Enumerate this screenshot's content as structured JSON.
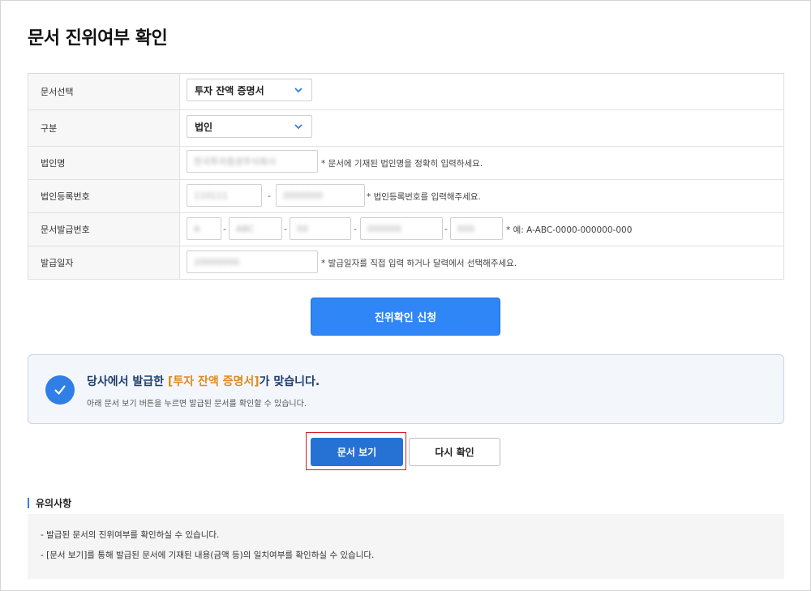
{
  "page": {
    "title": "문서 진위여부 확인"
  },
  "form": {
    "doc_select": {
      "label": "문서선택",
      "value": "투자 잔액 증명서"
    },
    "category": {
      "label": "구분",
      "value": "법인"
    },
    "corp_name": {
      "label": "법인명",
      "value": "한국투자증권주식회사",
      "hint": "* 문서에 기재된 법인명을 정확히 입력하세요."
    },
    "corp_reg_no": {
      "label": "법인등록번호",
      "part1": "110111",
      "part2": "0000000",
      "hint": "* 법인등록번호를 입력해주세요."
    },
    "doc_issue_no": {
      "label": "문서발급번호",
      "parts": [
        "A",
        "ABC",
        "00",
        "000000",
        "000"
      ],
      "hint": "* 예: A-ABC-0000-000000-000"
    },
    "issue_date": {
      "label": "발급일자",
      "value": "20000000",
      "hint": "* 발급일자를 직접 입력 하거나 달력에서 선택해주세요."
    }
  },
  "buttons": {
    "submit": "진위확인 신청",
    "view_doc": "문서 보기",
    "recheck": "다시 확인"
  },
  "result": {
    "title_prefix": "당사에서 발급한 ",
    "title_highlight": "[투자 잔액 증명서]",
    "title_suffix": "가 맞습니다.",
    "subtitle": "아래 문서 보기 버튼을 누르면 발급된 문서를 확인할 수 있습니다."
  },
  "notice": {
    "heading": "유의사항",
    "items": [
      "- 발급된 문서의 진위여부를 확인하실 수 있습니다.",
      "- [문서 보기]를 통해 발급된 문서에 기재된 내용(금액 등)의 일치여부를 확인하실 수 있습니다."
    ]
  },
  "colors": {
    "primary": "#2f86f6",
    "view_button": "#2672d4",
    "highlight_text": "#e08a1e",
    "selection_frame": "#d11f2b"
  },
  "icons": {
    "select_arrow": "chevron-down-icon",
    "result_check": "check-icon"
  }
}
